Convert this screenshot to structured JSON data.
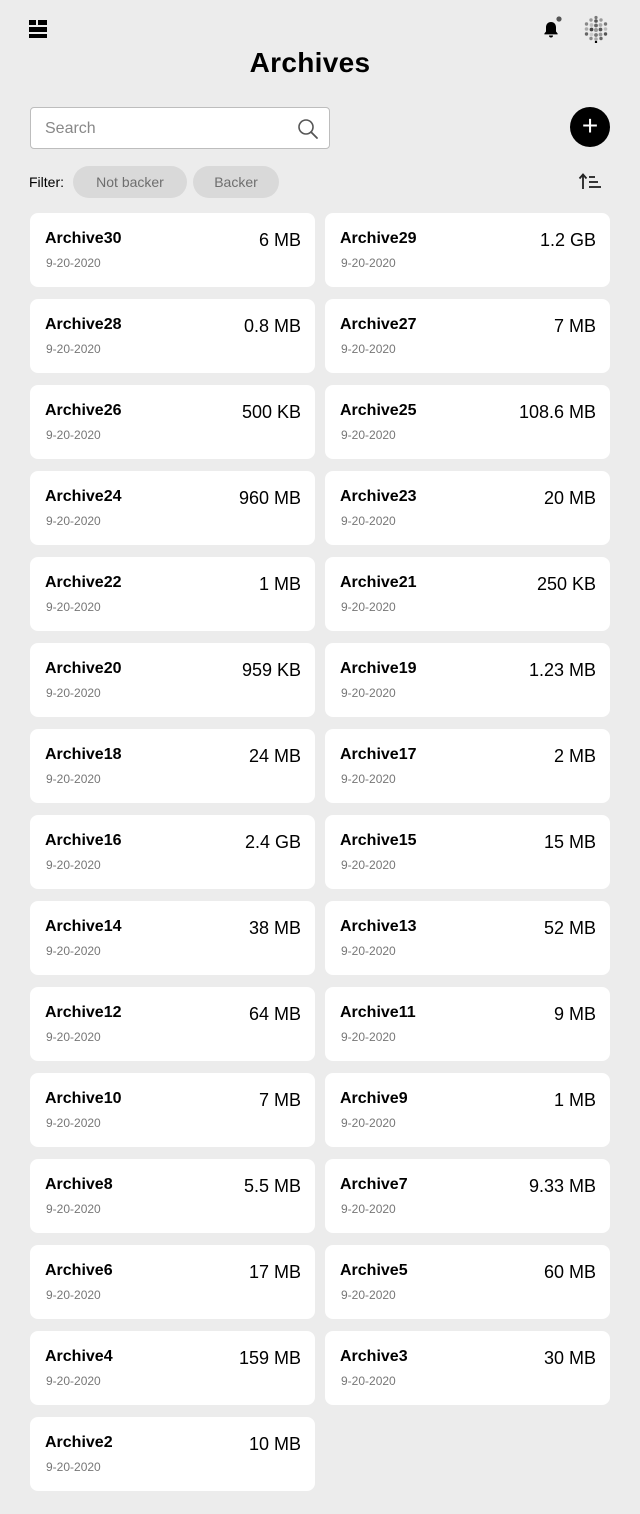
{
  "header": {
    "title": "Archives"
  },
  "search": {
    "placeholder": "Search",
    "value": ""
  },
  "toolbar": {
    "add_label": "+"
  },
  "filter": {
    "label": "Filter:",
    "chips": [
      "Not backer",
      "Backer"
    ]
  },
  "icons": {
    "menu": "menu-grid-icon",
    "notifications": "bell-icon",
    "profile": "avatar-dots-icon",
    "search": "magnifier-icon",
    "sort": "sort-ascending-icon"
  },
  "colors": {
    "background": "#ececec",
    "card": "#ffffff",
    "chip": "#d9d9d9",
    "accent": "#000000"
  },
  "archives": [
    {
      "name": "Archive30",
      "size": "6 MB",
      "date": "9-20-2020"
    },
    {
      "name": "Archive29",
      "size": "1.2 GB",
      "date": "9-20-2020"
    },
    {
      "name": "Archive28",
      "size": "0.8 MB",
      "date": "9-20-2020"
    },
    {
      "name": "Archive27",
      "size": "7 MB",
      "date": "9-20-2020"
    },
    {
      "name": "Archive26",
      "size": "500 KB",
      "date": "9-20-2020"
    },
    {
      "name": "Archive25",
      "size": "108.6 MB",
      "date": "9-20-2020"
    },
    {
      "name": "Archive24",
      "size": "960 MB",
      "date": "9-20-2020"
    },
    {
      "name": "Archive23",
      "size": "20 MB",
      "date": "9-20-2020"
    },
    {
      "name": "Archive22",
      "size": "1 MB",
      "date": "9-20-2020"
    },
    {
      "name": "Archive21",
      "size": "250 KB",
      "date": "9-20-2020"
    },
    {
      "name": "Archive20",
      "size": "959 KB",
      "date": "9-20-2020"
    },
    {
      "name": "Archive19",
      "size": "1.23 MB",
      "date": "9-20-2020"
    },
    {
      "name": "Archive18",
      "size": "24 MB",
      "date": "9-20-2020"
    },
    {
      "name": "Archive17",
      "size": "2 MB",
      "date": "9-20-2020"
    },
    {
      "name": "Archive16",
      "size": "2.4 GB",
      "date": "9-20-2020"
    },
    {
      "name": "Archive15",
      "size": "15 MB",
      "date": "9-20-2020"
    },
    {
      "name": "Archive14",
      "size": "38 MB",
      "date": "9-20-2020"
    },
    {
      "name": "Archive13",
      "size": "52 MB",
      "date": "9-20-2020"
    },
    {
      "name": "Archive12",
      "size": "64 MB",
      "date": "9-20-2020"
    },
    {
      "name": "Archive11",
      "size": "9 MB",
      "date": "9-20-2020"
    },
    {
      "name": "Archive10",
      "size": "7 MB",
      "date": "9-20-2020"
    },
    {
      "name": "Archive9",
      "size": "1 MB",
      "date": "9-20-2020"
    },
    {
      "name": "Archive8",
      "size": "5.5 MB",
      "date": "9-20-2020"
    },
    {
      "name": "Archive7",
      "size": "9.33 MB",
      "date": "9-20-2020"
    },
    {
      "name": "Archive6",
      "size": "17 MB",
      "date": "9-20-2020"
    },
    {
      "name": "Archive5",
      "size": "60 MB",
      "date": "9-20-2020"
    },
    {
      "name": "Archive4",
      "size": "159 MB",
      "date": "9-20-2020"
    },
    {
      "name": "Archive3",
      "size": "30 MB",
      "date": "9-20-2020"
    },
    {
      "name": "Archive2",
      "size": "10 MB",
      "date": "9-20-2020"
    }
  ]
}
